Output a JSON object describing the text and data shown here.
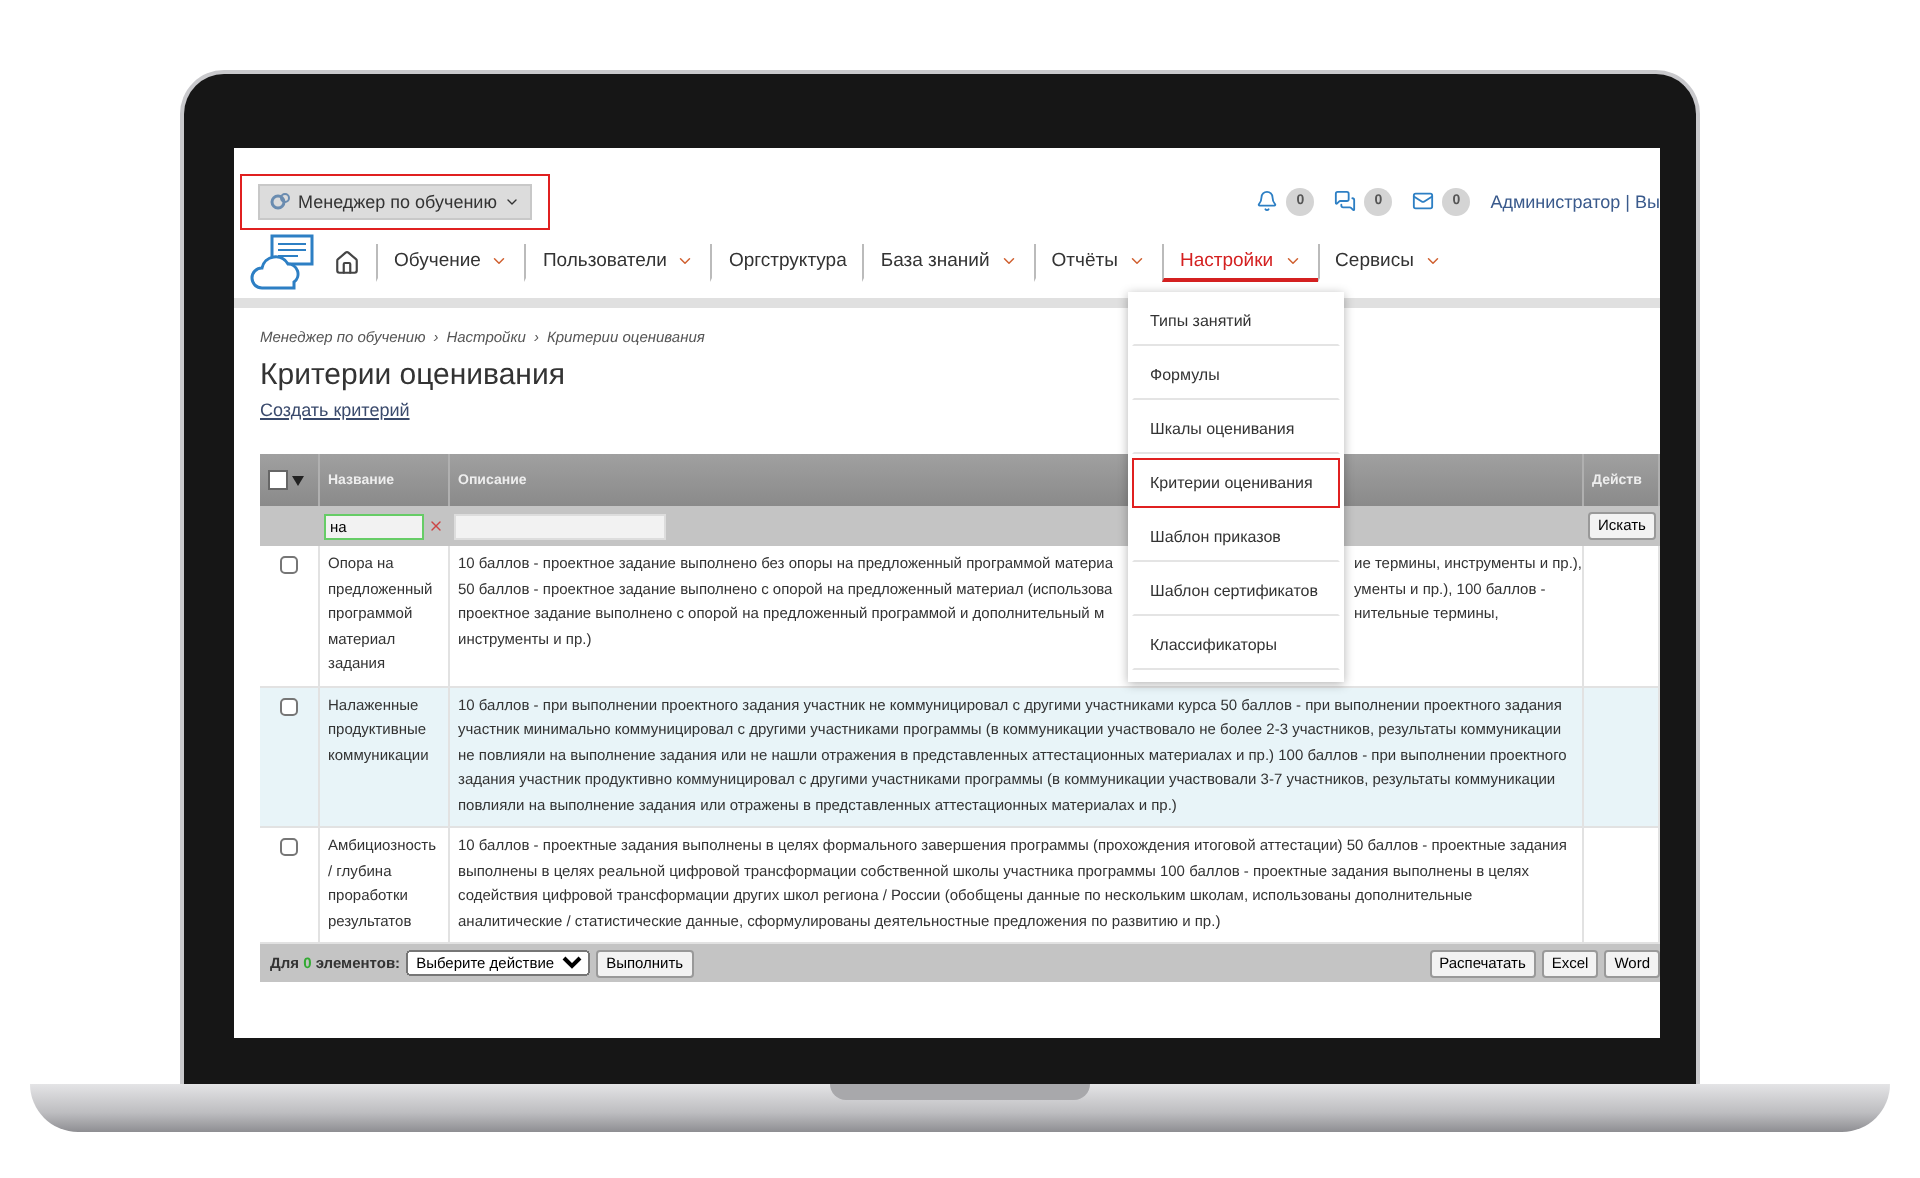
{
  "role_selector": {
    "label": "Менеджер по обучению",
    "highlighted": true
  },
  "notifications": [
    {
      "kind": "bell",
      "count": "0"
    },
    {
      "kind": "chat",
      "count": "0"
    },
    {
      "kind": "mail",
      "count": "0"
    }
  ],
  "user": {
    "name": "Администратор",
    "separator": "|",
    "logout": "Вы"
  },
  "nav": [
    {
      "label": "Обучение",
      "has_menu": true,
      "selected": false
    },
    {
      "label": "Пользователи",
      "has_menu": true,
      "selected": false
    },
    {
      "label": "Оргструктура",
      "has_menu": false,
      "selected": false
    },
    {
      "label": "База знаний",
      "has_menu": true,
      "selected": false
    },
    {
      "label": "Отчёты",
      "has_menu": true,
      "selected": false
    },
    {
      "label": "Настройки",
      "has_menu": true,
      "selected": true
    },
    {
      "label": "Сервисы",
      "has_menu": true,
      "selected": false
    }
  ],
  "settings_menu": [
    {
      "label": "Типы занятий",
      "selected": false
    },
    {
      "label": "Формулы",
      "selected": false
    },
    {
      "label": "Шкалы оценивания",
      "selected": false
    },
    {
      "label": "Критерии оценивания",
      "selected": true
    },
    {
      "label": "Шаблон приказов",
      "selected": false
    },
    {
      "label": "Шаблон сертификатов",
      "selected": false
    },
    {
      "label": "Классификаторы",
      "selected": false
    }
  ],
  "breadcrumb": {
    "separator": "›",
    "items": [
      "Менеджер по обучению",
      "Настройки",
      "Критерии оценивания"
    ]
  },
  "title": "Критерии оценивания",
  "create_link": "Создать критерий",
  "table": {
    "select_all": {
      "checked": false
    },
    "columns": [
      "Название",
      "Описание",
      "Действ"
    ],
    "filter": {
      "name_value": "на",
      "search_button": "Искать"
    },
    "rows": [
      {
        "kind": "covered",
        "checked": false,
        "highlighted": false,
        "name": "Опора на предложенный программой материал задания",
        "lines": [
          {
            "left": "10 баллов - проектное задание выполнено без опоры на предложенный программой материа",
            "right": "ие термины, инструменты и пр.),"
          },
          {
            "left": "50 баллов - проектное задание выполнено с опорой на предложенный материал (использова",
            "right": "ументы и пр.), 100 баллов -"
          },
          {
            "left": "проектное задание выполнено с опорой на предложенный программой и дополнительный м",
            "right": "нительные термины,"
          },
          {
            "left": "инструменты и пр.)"
          }
        ]
      },
      {
        "kind": "plain",
        "checked": false,
        "highlighted": true,
        "name": "Налаженные продуктивные коммуникации",
        "description": "10 баллов - при выполнении проектного задания участник не коммуницировал с другими участниками курса 50 баллов - при выполнении проектного задания участник минимально коммуницировал с другими участниками программы (в коммуникации участвовало не более 2-3 участников, результаты коммуникации не повлияли на выполнение задания или не нашли отражения в представленных аттестационных материалах и пр.) 100 баллов - при выполнении проектного задания участник продуктивно коммуницировал с другими участниками программы (в коммуникации участвовали 3-7 участников, результаты коммуникации повлияли на выполнение задания или отражены в представленных аттестационных материалах и пр.)"
      },
      {
        "kind": "plain",
        "checked": false,
        "highlighted": false,
        "name": "Амбициозность / глубина проработки результатов",
        "description": "10 баллов - проектные задания выполнены в целях формального завершения программы (прохождения итоговой аттестации) 50 баллов - проектные задания выполнены в целях реальной цифровой трансформации собственной школы участника программы 100 баллов - проектные задания выполнены в целях содействия цифровой трансформации других школ региона / России (обобщены данные по нескольким школам, использованы дополнительные аналитические / статистические данные, сформулированы деятельностные предложения по развитию и пр.)"
      }
    ]
  },
  "footer": {
    "prefix": "Для",
    "count": "0",
    "suffix": "элементов:",
    "action_select": "Выберите действие",
    "run_button": "Выполнить",
    "export_buttons": [
      "Распечатать",
      "Excel",
      "Word"
    ]
  }
}
